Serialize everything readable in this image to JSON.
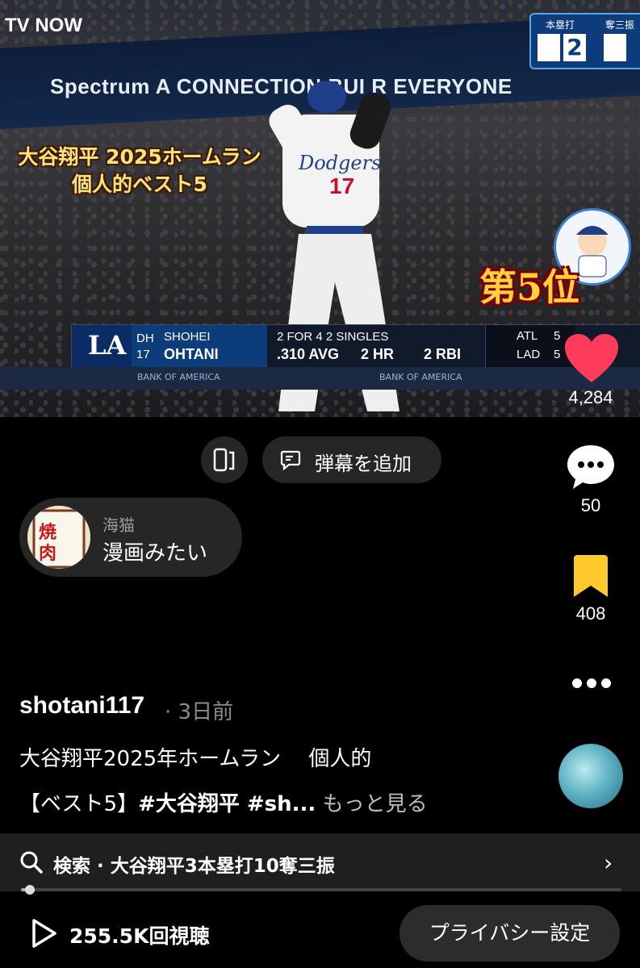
{
  "video": {
    "watermark": "TV NOW",
    "banner_text": "Spectrum  A CONNECTION BUI    R EVERYONE",
    "top_score": {
      "label_hr": "本塁打",
      "label_so": "奪三振",
      "hr_value": "2"
    },
    "overlay_title_line1": "大谷翔平 2025ホームラン",
    "overlay_title_line2": "個人的ベスト5",
    "rank_badge": "第5位",
    "jersey_number": "17",
    "team_name": "Dodgers",
    "score_bug": {
      "team_logo": "LA",
      "position": "DH",
      "number": "17",
      "first_name": "SHOHEI",
      "last_name": "OHTANI",
      "line1": "2 FOR 4  2 SINGLES",
      "avg": ".310 AVG",
      "hr": "2 HR",
      "rbi": "2 RBI",
      "away_team": "ATL",
      "away_score": "5",
      "home_team": "LAD",
      "home_score": "5"
    },
    "ad_strip": "BANK OF AMERICA"
  },
  "rail": {
    "likes": "4,284",
    "comments": "50",
    "saves": "408",
    "more_icon": "more-dots-icon"
  },
  "controls": {
    "danmaku_label": "弾幕を追加"
  },
  "top_comment": {
    "user": "海猫",
    "text": "漫画みたい"
  },
  "post": {
    "author": "shotani117",
    "ago": "· 3日前",
    "desc_line1": "大谷翔平2025年ホームラン　 個人的",
    "desc_line2_prefix": "【ベスト5】",
    "desc_line2_tags": "#大谷翔平 #sh...",
    "more_link": " もっと見る"
  },
  "search": {
    "text": "検索 · 大谷翔平3本塁打10奪三振",
    "progress": 0.01
  },
  "bottom": {
    "views": "255.5K回視聴",
    "privacy_label": "プライバシー設定"
  },
  "colors": {
    "like": "#ff3b5c",
    "save": "#fdc92c",
    "background": "#000000"
  }
}
